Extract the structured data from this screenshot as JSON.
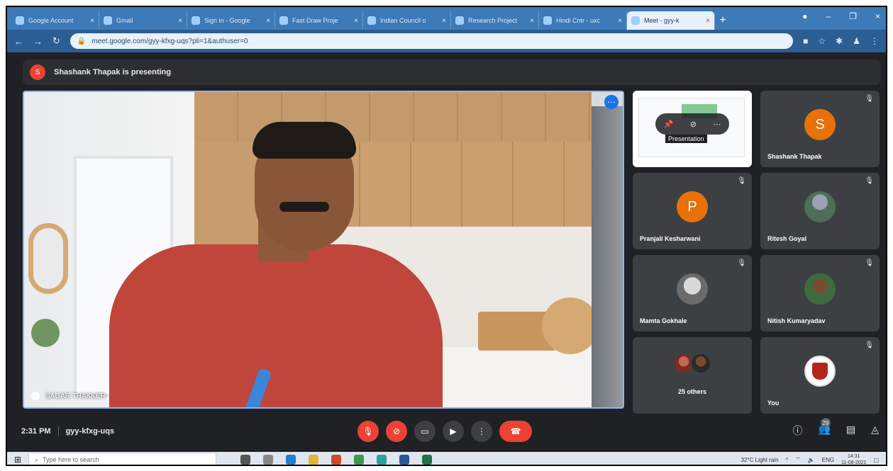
{
  "browser": {
    "tabs": [
      {
        "label": "Google Account",
        "active": false
      },
      {
        "label": "Gmail",
        "active": false
      },
      {
        "label": "Sign in - Google",
        "active": false
      },
      {
        "label": "Fast Draw Proje",
        "active": false
      },
      {
        "label": "Indian Council o",
        "active": false
      },
      {
        "label": "Research Project",
        "active": false
      },
      {
        "label": "Hindi Cntr - uxc",
        "active": false
      },
      {
        "label": "Meet - gyy-k",
        "active": true
      }
    ],
    "url": "meet.google.com/gyy-kfxg-uqs?pli=1&authuser=0",
    "accent": "#3c7ab8"
  },
  "banner": {
    "text": "Shashank Thapak is presenting",
    "initial": "S"
  },
  "main_video": {
    "name": "SAGAR THAKKER"
  },
  "participants": [
    {
      "name": "",
      "kind": "presentation",
      "label": "Presentation"
    },
    {
      "name": "Shashank Thapak",
      "kind": "initial",
      "initial": "S"
    },
    {
      "name": "Pranjali Kesharwani",
      "kind": "initial",
      "initial": "P"
    },
    {
      "name": "Ritesh Goyal",
      "kind": "photo"
    },
    {
      "name": "Mamta Gokhale",
      "kind": "photo"
    },
    {
      "name": "Nitish Kumaryadav",
      "kind": "photo"
    },
    {
      "name": "25 others",
      "kind": "group"
    },
    {
      "name": "You",
      "kind": "crest"
    }
  ],
  "controls": {
    "time": "2:31 PM",
    "meeting_code": "gyy-kfxg-uqs",
    "people_count": "29"
  },
  "taskbar": {
    "search_placeholder": "Type here to search",
    "weather": "32°C  Light rain",
    "lang": "ENG",
    "clock_time": "14:31",
    "clock_date": "11-08-2021"
  },
  "colors": {
    "meet_bg": "#202124",
    "tile_bg": "#3c4043",
    "danger": "#ea4335",
    "avatar_orange": "#e8710a",
    "focus_blue": "#8ab4f8"
  }
}
